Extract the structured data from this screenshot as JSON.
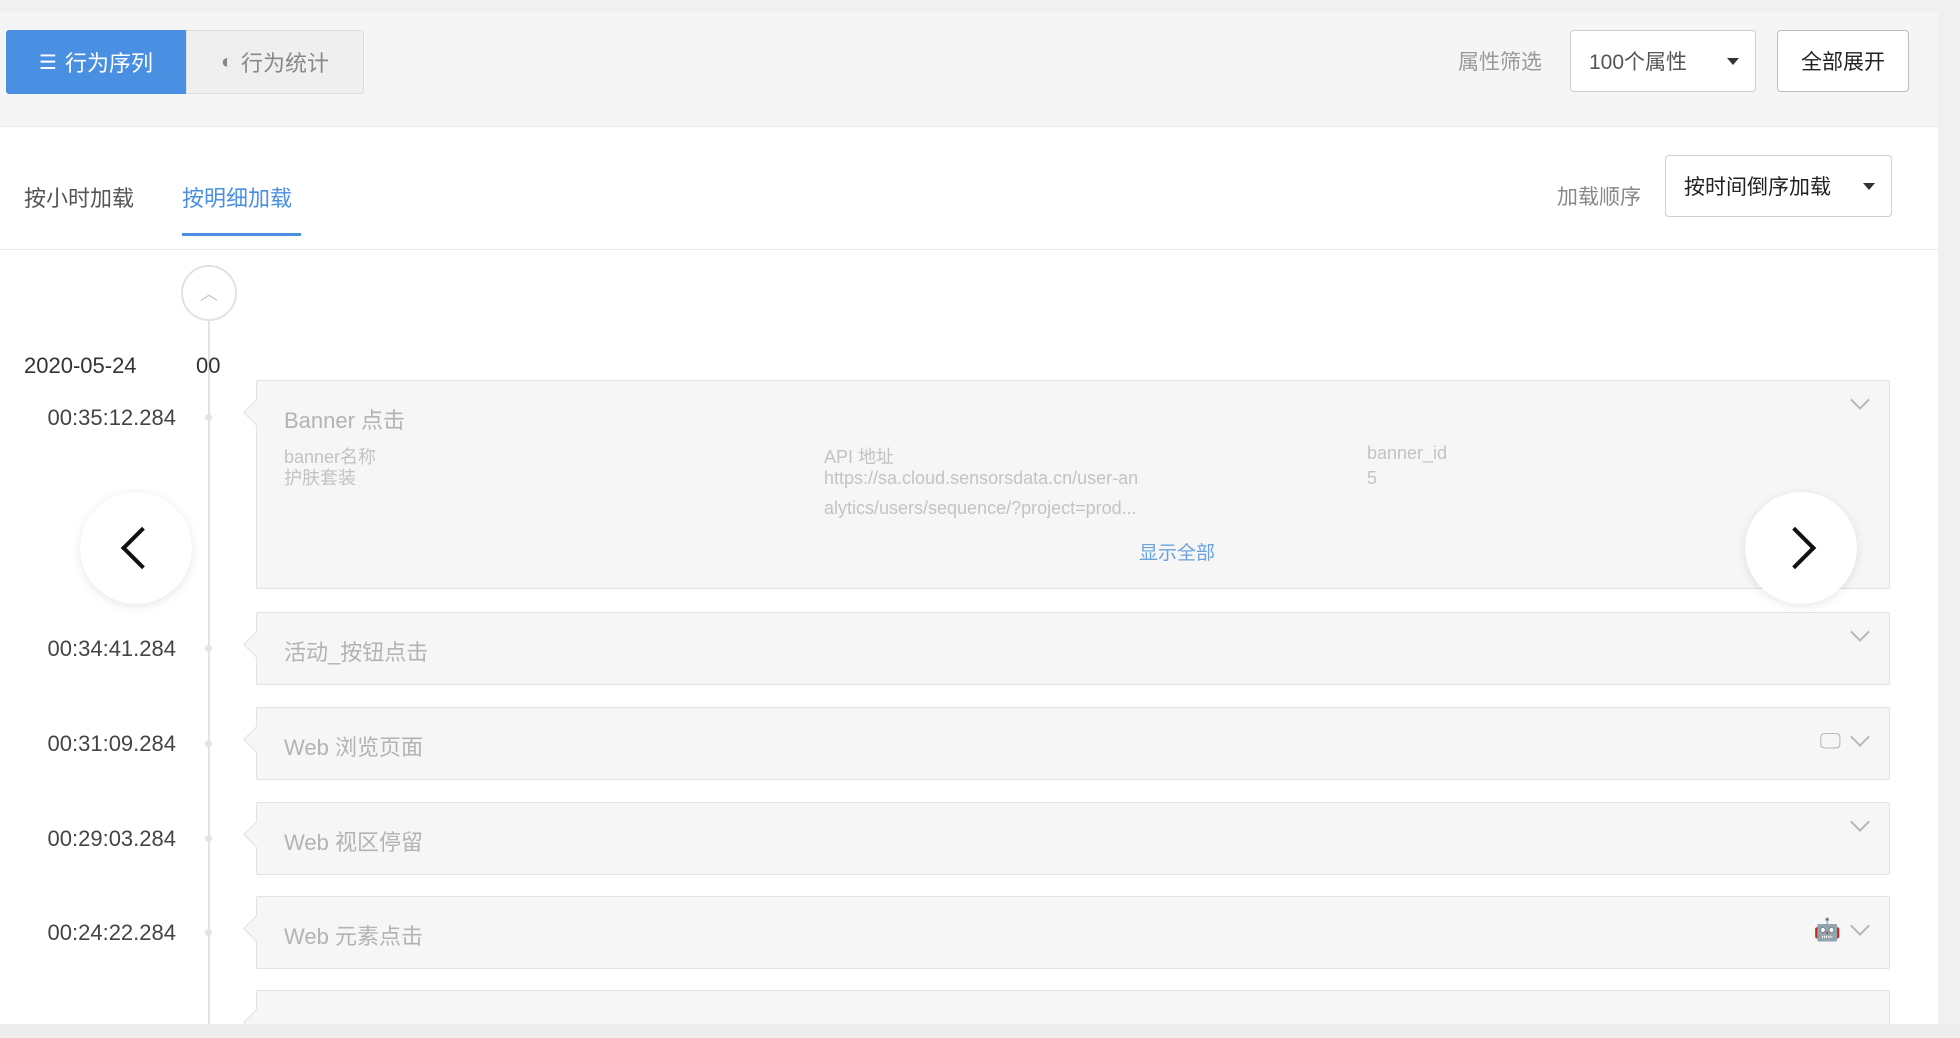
{
  "header": {
    "tab_sequence": "行为序列",
    "tab_stats": "行为统计",
    "filter_label": "属性筛选",
    "attr_select_value": "100个属性",
    "expand_all": "全部展开"
  },
  "subheader": {
    "tab_by_hour": "按小时加载",
    "tab_by_detail": "按明细加载",
    "order_label": "加载顺序",
    "order_select_value": "按时间倒序加载"
  },
  "timeline": {
    "date": "2020-05-24",
    "hour": "00",
    "events": [
      {
        "time": "00:35:12.284",
        "title": "Banner 点击",
        "platform_icon": "apple-icon",
        "props": [
          {
            "key": "banner名称",
            "value": "护肤套装"
          },
          {
            "key": "API 地址",
            "value_line1": "https://sa.cloud.sensorsdata.cn/user-an",
            "value_line2": "alytics/users/sequence/?project=prod..."
          },
          {
            "key": "banner_id",
            "value": "5"
          }
        ],
        "show_all": "显示全部"
      },
      {
        "time": "00:34:41.284",
        "title": "活动_按钮点击",
        "platform_icon": "apple-icon"
      },
      {
        "time": "00:31:09.284",
        "title": "Web 浏览页面",
        "platform_icon": "desktop-icon"
      },
      {
        "time": "00:29:03.284",
        "title": "Web 视区停留",
        "platform_icon": "apple-icon"
      },
      {
        "time": "00:24:22.284",
        "title": "Web 元素点击",
        "platform_icon": "android-icon"
      }
    ]
  },
  "colors": {
    "accent": "#4a90e2",
    "link": "#6aa1e0",
    "card_bg": "#f6f6f6",
    "muted_text": "#b3b3b3"
  }
}
